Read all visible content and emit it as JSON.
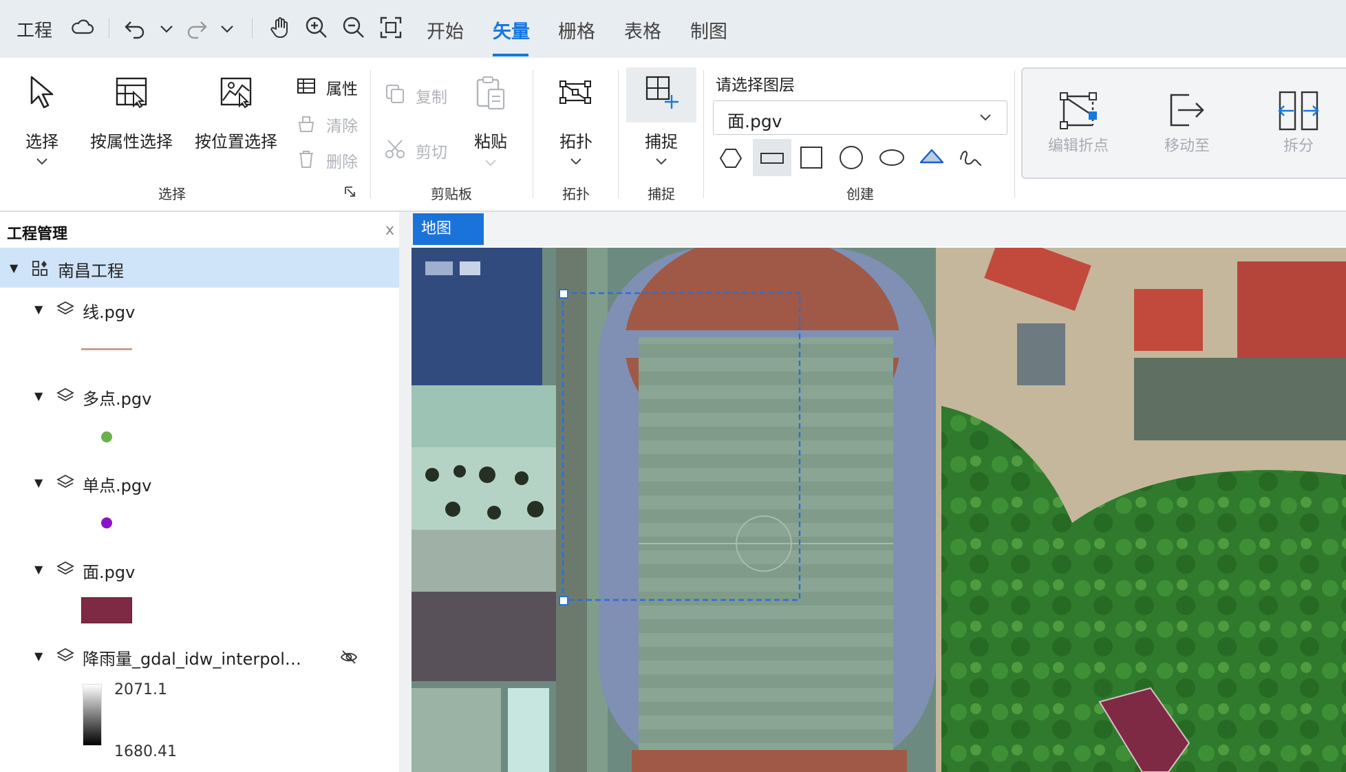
{
  "topbar": {
    "project_menu": "工程",
    "tabs": [
      {
        "label": "开始",
        "active": false
      },
      {
        "label": "矢量",
        "active": true
      },
      {
        "label": "栅格",
        "active": false
      },
      {
        "label": "表格",
        "active": false
      },
      {
        "label": "制图",
        "active": false
      }
    ],
    "icons": [
      "cloud-icon",
      "undo-icon",
      "chevron-down-icon",
      "redo-icon",
      "chevron-down-icon",
      "pan-hand-icon",
      "zoom-in-icon",
      "zoom-out-icon",
      "full-extent-icon"
    ]
  },
  "ribbon": {
    "select_group": {
      "select_label": "选择",
      "attr_select_label": "按属性选择",
      "location_select_label": "按位置选择",
      "attributes_label": "属性",
      "clear_label": "清除",
      "delete_label": "删除",
      "group_label": "选择"
    },
    "clipboard_group": {
      "copy_label": "复制",
      "cut_label": "剪切",
      "paste_label": "粘贴",
      "group_label": "剪贴板"
    },
    "topology_group": {
      "button_label": "拓扑",
      "group_label": "拓扑"
    },
    "snap_group": {
      "button_label": "捕捉",
      "group_label": "捕捉"
    },
    "create_group": {
      "layer_prompt": "请选择图层",
      "layer_selected": "面.pgv",
      "group_label": "创建",
      "shape_tools": [
        "polygon-icon",
        "rectangle-icon",
        "square-icon",
        "circle-icon",
        "ellipse-icon",
        "triangle-icon",
        "freehand-icon"
      ]
    },
    "edit_group": {
      "edit_vertices_label": "编辑折点",
      "move_to_label": "移动至",
      "split_label": "拆分"
    }
  },
  "project_panel": {
    "title": "工程管理",
    "close_label": "x",
    "project_name": "南昌工程",
    "layers": [
      {
        "name": "线.pgv",
        "legend": "line",
        "color": "#c9a08a"
      },
      {
        "name": "多点.pgv",
        "legend": "point",
        "color": "#6ab04c"
      },
      {
        "name": "单点.pgv",
        "legend": "point",
        "color": "#8a12c8"
      },
      {
        "name": "面.pgv",
        "legend": "polygon",
        "color": "#7e2a44"
      },
      {
        "name": "降雨量_gdal_idw_interpol…",
        "legend": "gradient",
        "max_label": "2071.1",
        "min_label": "1680.41",
        "hidden": true
      }
    ]
  },
  "map": {
    "tab_label": "地图",
    "colors": {
      "selection": "#2a6fd6",
      "polygon_fill": "#7e2a44"
    }
  }
}
